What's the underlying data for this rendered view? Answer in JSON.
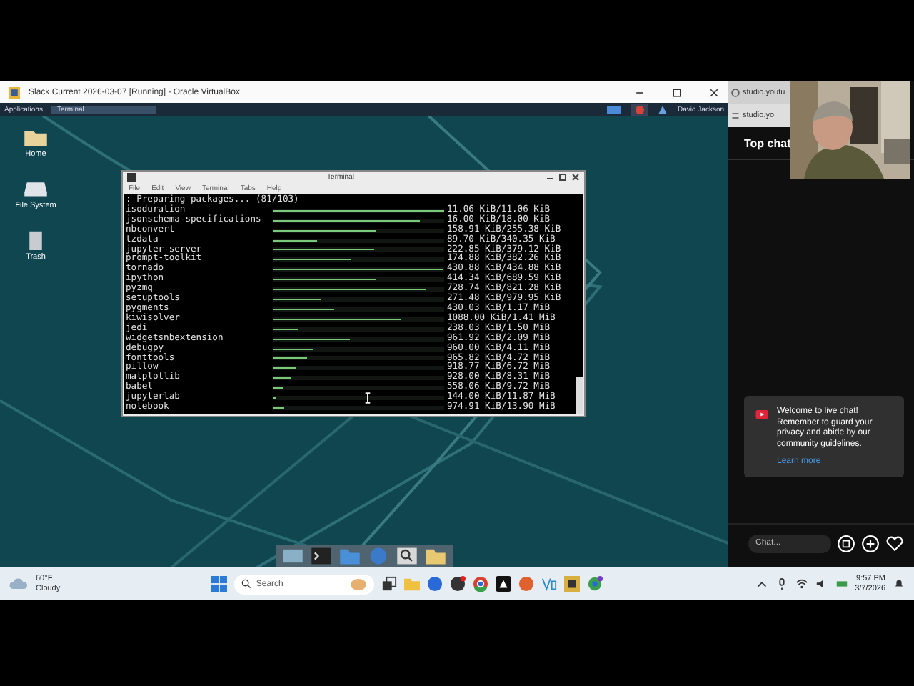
{
  "host_window": {
    "title": "Slack Current 2026-03-07 [Running] - Oracle VirtualBox"
  },
  "guest_panel": {
    "menu": "Applications",
    "task": "Terminal",
    "user": "David Jackson"
  },
  "desktop_icons": [
    {
      "label": "Home",
      "kind": "folder"
    },
    {
      "label": "File System",
      "kind": "drive"
    },
    {
      "label": "Trash",
      "kind": "trash"
    }
  ],
  "terminal": {
    "title": "Terminal",
    "menu": [
      "File",
      "Edit",
      "View",
      "Terminal",
      "Tabs",
      "Help"
    ],
    "header": ": Preparing packages... (81/103)",
    "rows": [
      {
        "name": "isoduration",
        "level": 1.0,
        "size": "11.06 KiB/11.06 KiB"
      },
      {
        "name": "jsonschema-specifications",
        "level": 0.86,
        "size": "16.00 KiB/18.00 KiB"
      },
      {
        "name": "nbconvert",
        "level": 0.6,
        "size": "158.91 KiB/255.38 KiB"
      },
      {
        "name": "tzdata",
        "level": 0.26,
        "size": "89.70 KiB/340.35 KiB"
      },
      {
        "name": "jupyter-server",
        "level": 0.59,
        "size": "222.85 KiB/379.12 KiB"
      },
      {
        "name": "prompt-toolkit",
        "level": 0.46,
        "size": "174.88 KiB/382.26 KiB"
      },
      {
        "name": "tornado",
        "level": 0.99,
        "size": "430.88 KiB/434.88 KiB"
      },
      {
        "name": "ipython",
        "level": 0.6,
        "size": "414.34 KiB/689.59 KiB"
      },
      {
        "name": "pyzmq",
        "level": 0.89,
        "size": "728.74 KiB/821.28 KiB"
      },
      {
        "name": "setuptools",
        "level": 0.28,
        "size": "271.48 KiB/979.95 KiB"
      },
      {
        "name": "pygments",
        "level": 0.36,
        "size": "430.03 KiB/1.17 MiB"
      },
      {
        "name": "kiwisolver",
        "level": 0.75,
        "size": "1088.00 KiB/1.41 MiB"
      },
      {
        "name": "jedi",
        "level": 0.15,
        "size": "238.03 KiB/1.50 MiB"
      },
      {
        "name": "widgetsnbextension",
        "level": 0.45,
        "size": "961.92 KiB/2.09 MiB"
      },
      {
        "name": "debugpy",
        "level": 0.23,
        "size": "960.00 KiB/4.11 MiB"
      },
      {
        "name": "fonttools",
        "level": 0.2,
        "size": "965.82 KiB/4.72 MiB"
      },
      {
        "name": "pillow",
        "level": 0.13,
        "size": "918.77 KiB/6.72 MiB"
      },
      {
        "name": "matplotlib",
        "level": 0.11,
        "size": "928.00 KiB/8.31 MiB"
      },
      {
        "name": "babel",
        "level": 0.06,
        "size": "558.06 KiB/9.72 MiB"
      },
      {
        "name": "jupyterlab",
        "level": 0.02,
        "size": "144.00 KiB/11.87 MiB"
      },
      {
        "name": "notebook",
        "level": 0.07,
        "size": "974.91 KiB/13.90 MiB"
      }
    ]
  },
  "chat_panel": {
    "tab_1": "studio.youtu",
    "tab_2": "studio.yo",
    "heading": "Top chat",
    "notice": "Welcome to live chat! Remember to guard your privacy and abide by our community guidelines.",
    "notice_link": "Learn more",
    "input": {
      "placeholder": "Chat..."
    }
  },
  "taskbar": {
    "weather_temp": "60°F",
    "weather_text": "Cloudy",
    "search": {
      "placeholder": "Search"
    },
    "time": "9:57 PM",
    "date": "3/7/2026"
  }
}
